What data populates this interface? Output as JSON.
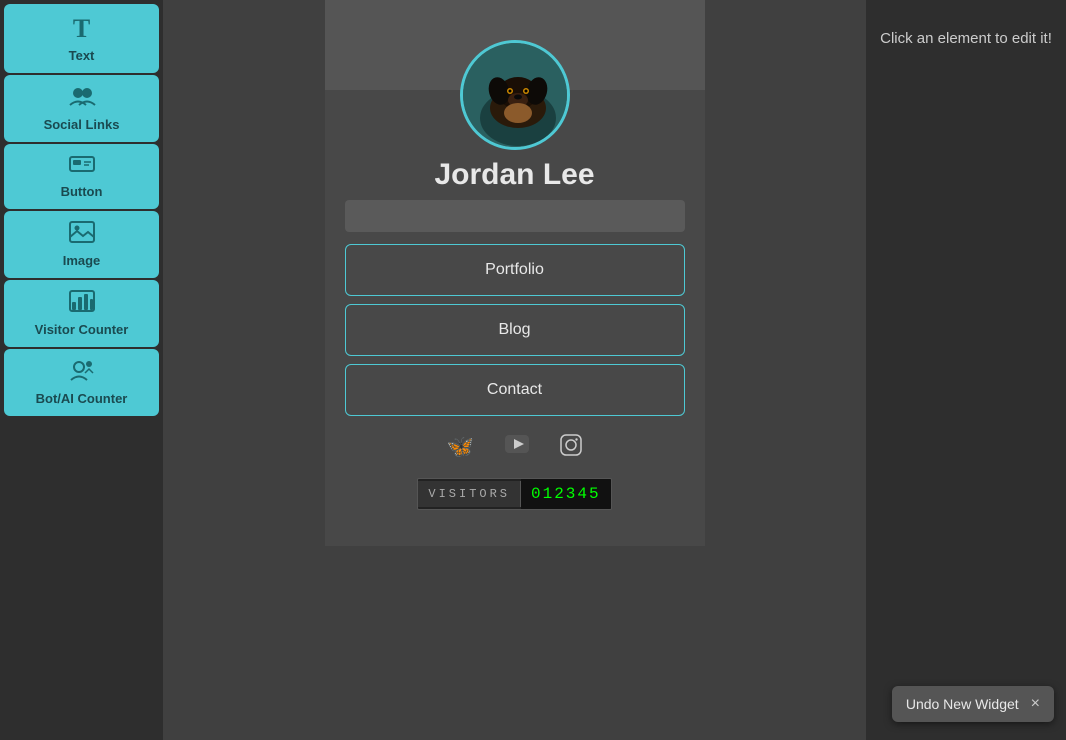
{
  "sidebar": {
    "items": [
      {
        "id": "text",
        "label": "Text",
        "icon": "T",
        "icon_type": "letter"
      },
      {
        "id": "social-links",
        "label": "Social Links",
        "icon": "👥",
        "icon_type": "emoji"
      },
      {
        "id": "button",
        "label": "Button",
        "icon": "🖥",
        "icon_type": "emoji"
      },
      {
        "id": "image",
        "label": "Image",
        "icon": "🖼",
        "icon_type": "emoji"
      },
      {
        "id": "visitor-counter",
        "label": "Visitor Counter",
        "icon": "📊",
        "icon_type": "emoji"
      },
      {
        "id": "bot-ai-counter",
        "label": "Bot/AI Counter",
        "icon": "👤",
        "icon_type": "emoji"
      }
    ]
  },
  "profile": {
    "name": "Jordan Lee",
    "buttons": [
      {
        "label": "Portfolio"
      },
      {
        "label": "Blog"
      },
      {
        "label": "Contact"
      }
    ],
    "social_icons": [
      {
        "name": "butterfly",
        "glyph": "🦋"
      },
      {
        "name": "youtube",
        "glyph": "▶"
      },
      {
        "name": "instagram",
        "glyph": "📷"
      }
    ]
  },
  "visitor_counter": {
    "label": "VISITORS",
    "count": "012345"
  },
  "right_panel": {
    "hint": "Click an element to edit it!"
  },
  "undo_toast": {
    "label": "Undo New Widget",
    "close_label": "×"
  }
}
